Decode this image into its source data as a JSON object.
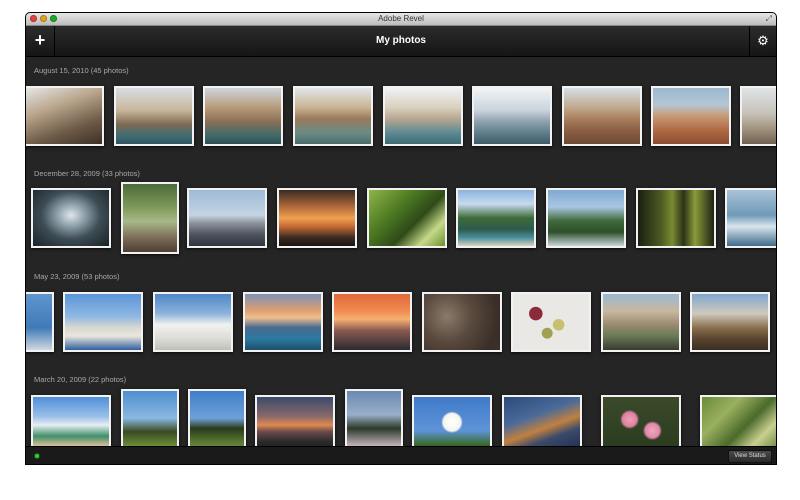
{
  "window": {
    "title": "Adobe Revel"
  },
  "toolbar": {
    "page_title": "My photos",
    "add_icon": "plus-icon",
    "settings_icon": "gear-icon"
  },
  "sections": [
    {
      "label": "August 15, 2010 (45 photos)"
    },
    {
      "label": "December 28, 2009 (33 photos)"
    },
    {
      "label": "May 23, 2009 (53 photos)"
    },
    {
      "label": "March 20, 2009 (22 photos)"
    }
  ],
  "statusbar": {
    "button_label": "View Status",
    "indicator_color": "#2fd12f"
  },
  "colors": {
    "background": "#252525",
    "toolbar": "#1e1e1e",
    "thumb_border": "#f2f2f2"
  }
}
